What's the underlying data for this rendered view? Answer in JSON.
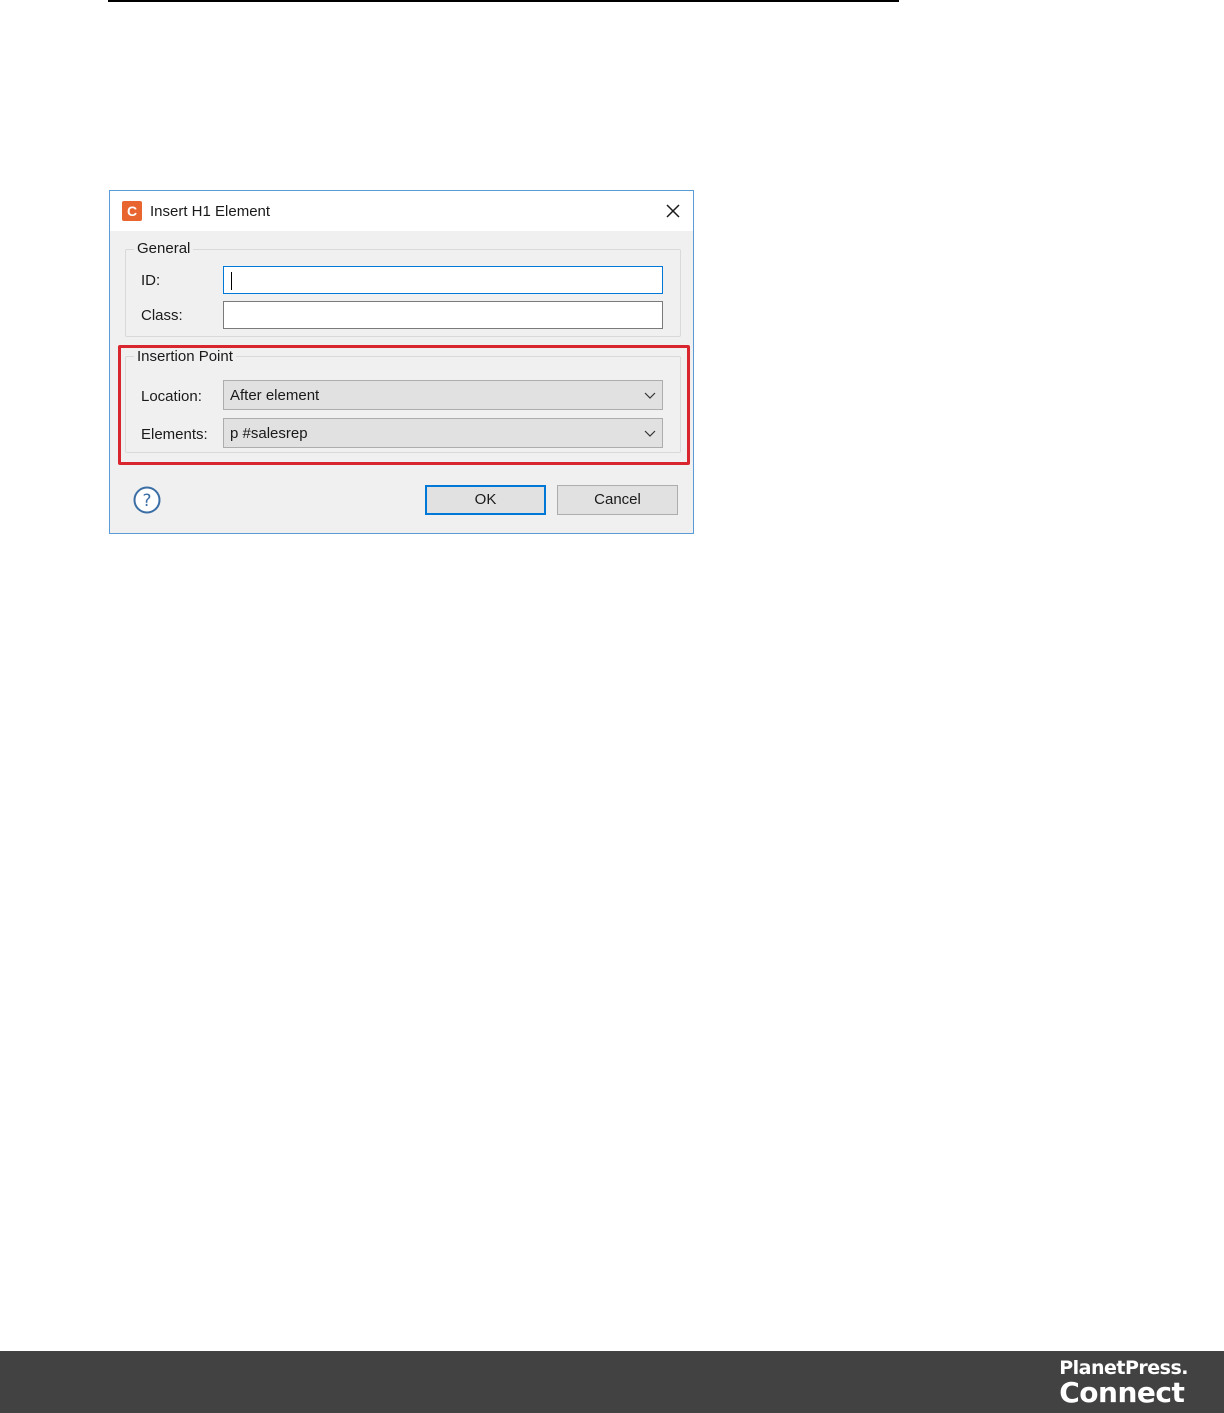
{
  "dialog": {
    "title": "Insert H1 Element",
    "app_icon_letter": "C",
    "general": {
      "legend": "General",
      "id_label": "ID:",
      "id_value": "",
      "class_label": "Class:",
      "class_value": ""
    },
    "insertion_point": {
      "legend": "Insertion Point",
      "location_label": "Location:",
      "location_value": "After element",
      "elements_label": "Elements:",
      "elements_value": "p #salesrep"
    },
    "buttons": {
      "ok_label": "OK",
      "cancel_label": "Cancel"
    }
  },
  "footer": {
    "brand_line1": "PlanetPress.",
    "brand_line2": "Connect"
  },
  "colors": {
    "highlight": "#d9262e",
    "focus": "#0078d7",
    "app_icon": "#e8652f",
    "footer_bg": "#424242"
  }
}
